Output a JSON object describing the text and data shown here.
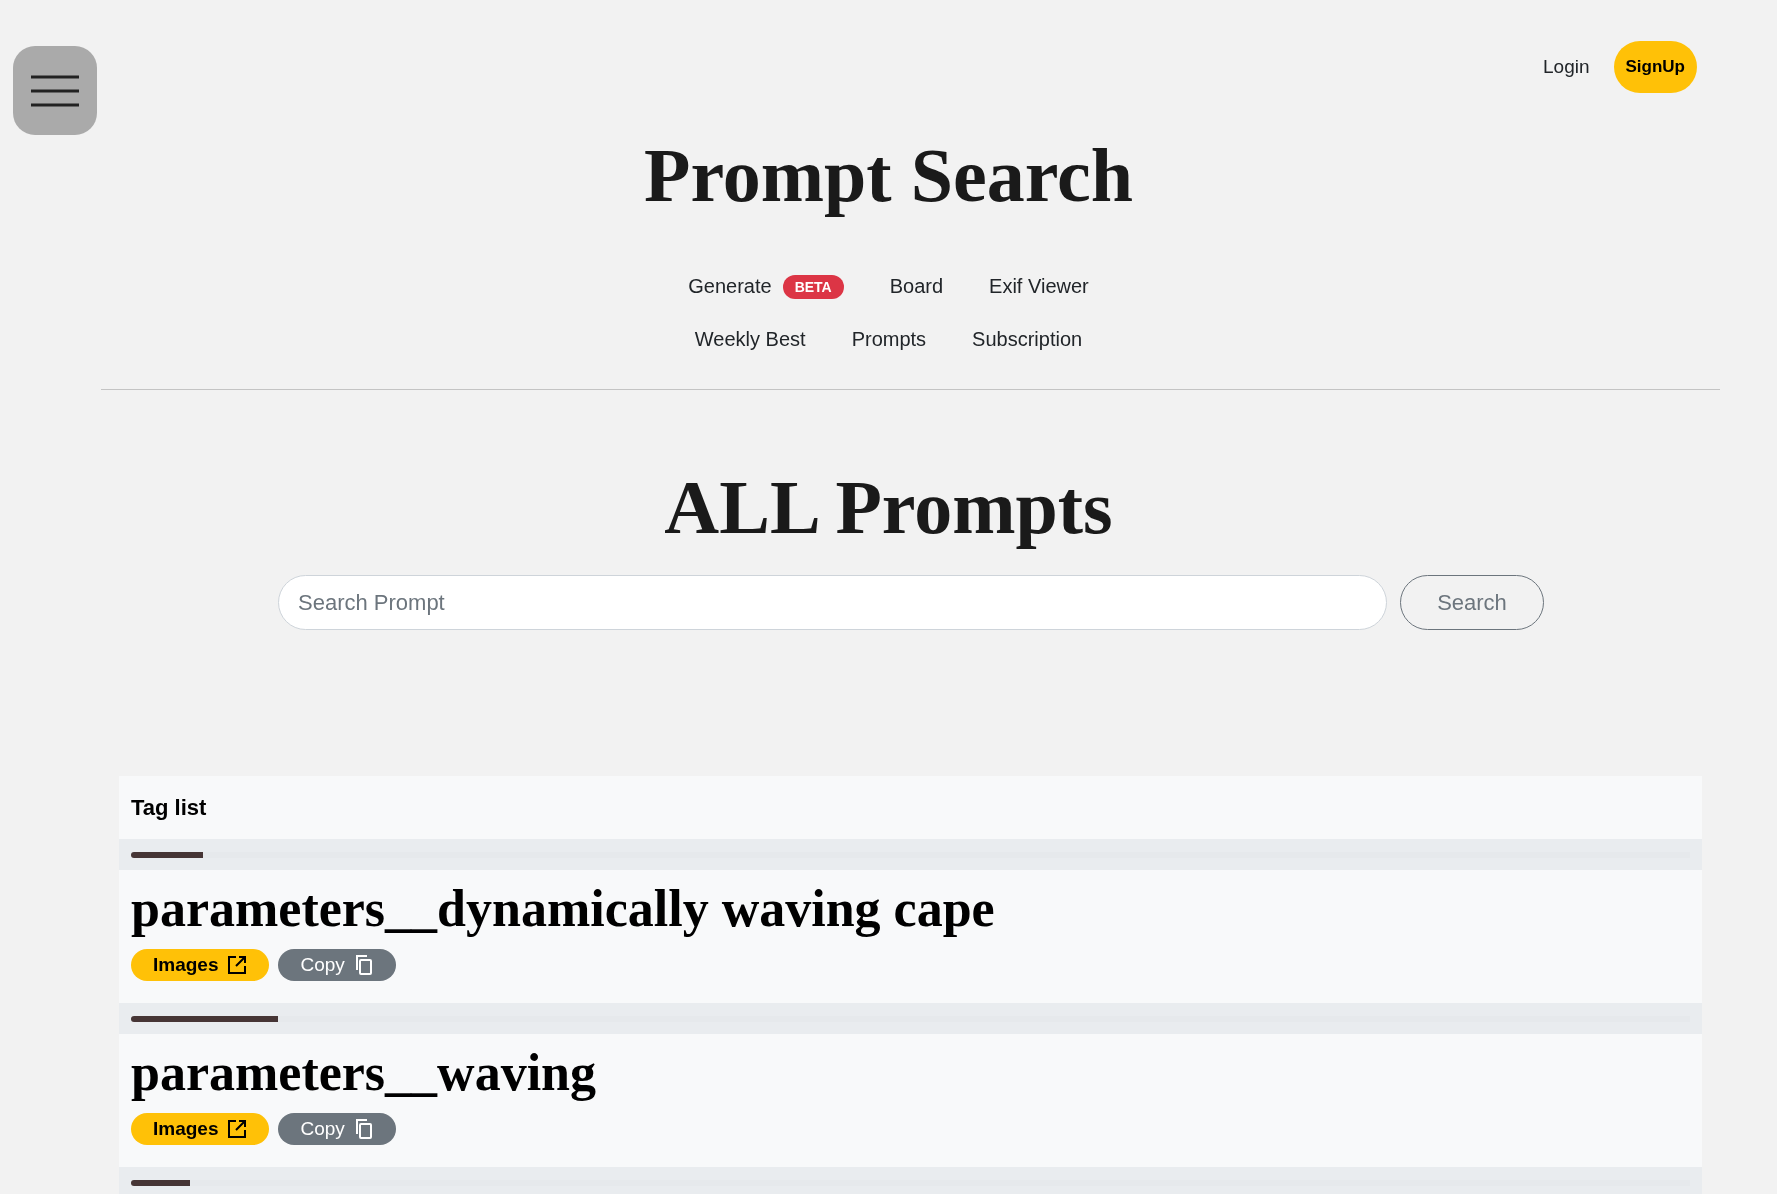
{
  "header": {
    "login": "Login",
    "signup": "SignUp"
  },
  "site_title": "Prompt Search",
  "nav_rows": [
    {
      "items": [
        {
          "label": "Generate",
          "badge": "BETA"
        },
        {
          "label": "Board"
        },
        {
          "label": "Exif Viewer"
        }
      ]
    },
    {
      "items": [
        {
          "label": "Weekly Best"
        },
        {
          "label": "Prompts"
        },
        {
          "label": "Subscription"
        }
      ]
    }
  ],
  "page_title": "ALL Prompts",
  "search": {
    "placeholder": "Search Prompt",
    "button": "Search"
  },
  "tag_list": {
    "title": "Tag list",
    "tags": [
      {
        "level": 0.046,
        "name": "parameters__dynamically waving cape",
        "buttons": [
          {
            "kind": "images",
            "label": "Images"
          },
          {
            "kind": "copy",
            "label": "Copy"
          }
        ]
      },
      {
        "level": 0.094,
        "name": "parameters__waving",
        "buttons": [
          {
            "kind": "images",
            "label": "Images"
          },
          {
            "kind": "copy",
            "label": "Copy"
          }
        ]
      },
      {
        "level": 0.038
      }
    ]
  }
}
